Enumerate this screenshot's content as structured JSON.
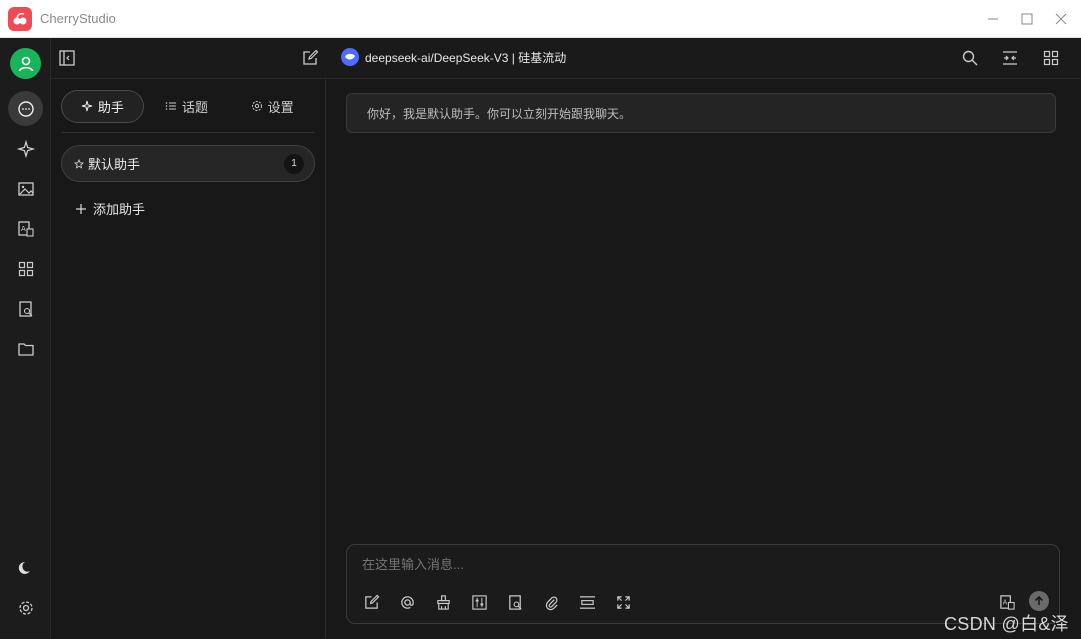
{
  "window": {
    "title": "CherryStudio"
  },
  "topbar": {
    "model_label": "deepseek-ai/DeepSeek-V3 | 硅基流动"
  },
  "sidebar": {
    "tabs": [
      {
        "label": "助手",
        "icon": "sparkle-icon",
        "active": true
      },
      {
        "label": "话题",
        "icon": "list-icon",
        "active": false
      },
      {
        "label": "设置",
        "icon": "gear-icon",
        "active": false
      }
    ],
    "assistants": [
      {
        "name": "默认助手",
        "count": "1"
      }
    ],
    "add_label": "添加助手"
  },
  "chat": {
    "welcome": "你好，我是默认助手。你可以立刻开始跟我聊天。"
  },
  "composer": {
    "placeholder": "在这里输入消息..."
  },
  "rail": {
    "items": [
      "chat-icon",
      "sparkle-icon",
      "image-icon",
      "translate-icon",
      "apps-icon",
      "knowledge-icon",
      "folder-icon"
    ],
    "bottom": [
      "moon-icon",
      "gear-icon"
    ]
  },
  "watermark": "CSDN @白&泽",
  "colors": {
    "background": "#181818",
    "avatar": "#19b35b",
    "logo": "#f04b55",
    "model_logo": "#4d6bfe"
  }
}
